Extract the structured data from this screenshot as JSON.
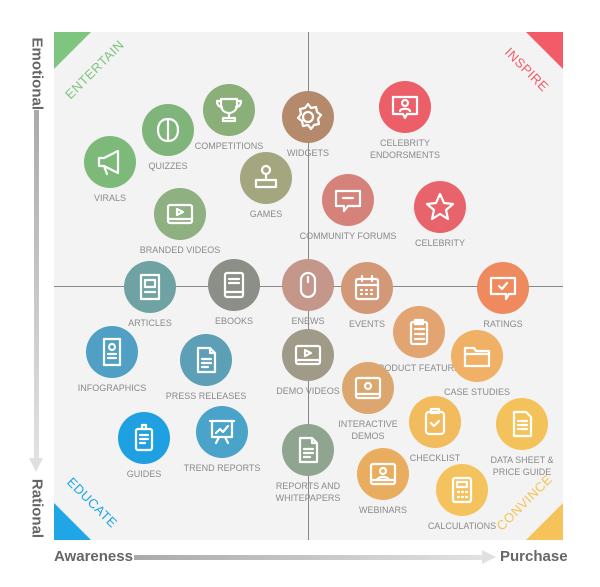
{
  "axes": {
    "top": "Emotional",
    "bottom": "Rational",
    "left": "Awareness",
    "right": "Purchase"
  },
  "quadrants": [
    {
      "label": "ENTERTAIN",
      "color": "#7fc47f",
      "corner": "top-left"
    },
    {
      "label": "INSPIRE",
      "color": "#f45b69",
      "corner": "top-right"
    },
    {
      "label": "EDUCATE",
      "color": "#1ea6e6",
      "corner": "bottom-left"
    },
    {
      "label": "CONVINCE",
      "color": "#f5c35a",
      "corner": "bottom-right"
    }
  ],
  "items": [
    {
      "label": "VIRALS",
      "icon": "megaphone-icon",
      "color": "#7dba7a"
    },
    {
      "label": "QUIZZES",
      "icon": "brain-icon",
      "color": "#7fb47a"
    },
    {
      "label": "COMPETITIONS",
      "icon": "trophy-icon",
      "color": "#8aaf78"
    },
    {
      "label": "WIDGETS",
      "icon": "gear-icon",
      "color": "#b58a6c"
    },
    {
      "label": "CELEBRITY ENDORSMENTS",
      "icon": "chat-person-icon",
      "color": "#ec5f69"
    },
    {
      "label": "GAMES",
      "icon": "joystick-icon",
      "color": "#a3a67e"
    },
    {
      "label": "BRANDED VIDEOS",
      "icon": "video-icon",
      "color": "#8fb080"
    },
    {
      "label": "COMMUNITY FORUMS",
      "icon": "chat-icon",
      "color": "#d4827a"
    },
    {
      "label": "CELEBRITY",
      "icon": "star-icon",
      "color": "#e8646c"
    },
    {
      "label": "ARTICLES",
      "icon": "article-icon",
      "color": "#6fa3a3"
    },
    {
      "label": "EBOOKS",
      "icon": "book-icon",
      "color": "#8c8f88"
    },
    {
      "label": "ENEWS",
      "icon": "mouse-icon",
      "color": "#c4978a"
    },
    {
      "label": "EVENTS",
      "icon": "calendar-icon",
      "color": "#d29878"
    },
    {
      "label": "RATINGS",
      "icon": "chat-check-icon",
      "color": "#ee8a5e"
    },
    {
      "label": "INFOGRAPHICS",
      "icon": "infographic-icon",
      "color": "#4fa0c4"
    },
    {
      "label": "PRESS RELEASES",
      "icon": "document-icon",
      "color": "#5e9fb8"
    },
    {
      "label": "DEMO VIDEOS",
      "icon": "video-icon",
      "color": "#a09a88"
    },
    {
      "label": "PRODUCT FEATURES",
      "icon": "clipboard-list-icon",
      "color": "#e2a572"
    },
    {
      "label": "CASE STUDIES",
      "icon": "folder-icon",
      "color": "#f0b066"
    },
    {
      "label": "INTERACTIVE DEMOS",
      "icon": "monitor-icon",
      "color": "#dba76e"
    },
    {
      "label": "CHECKLIST",
      "icon": "clipboard-check-icon",
      "color": "#f1bb5e"
    },
    {
      "label": "DATA SHEET & PRICE GUIDE",
      "icon": "document-list-icon",
      "color": "#f4c25a"
    },
    {
      "label": "GUIDES",
      "icon": "clipboard-icon",
      "color": "#1fa0e0"
    },
    {
      "label": "TREND REPORTS",
      "icon": "presentation-icon",
      "color": "#4aa3c9"
    },
    {
      "label": "REPORTS AND WHITEPAPERS",
      "icon": "document-icon",
      "color": "#8fa590"
    },
    {
      "label": "WEBINARS",
      "icon": "webinar-icon",
      "color": "#e9ad60"
    },
    {
      "label": "CALCULATIONS",
      "icon": "calculator-icon",
      "color": "#f5c35e"
    }
  ]
}
